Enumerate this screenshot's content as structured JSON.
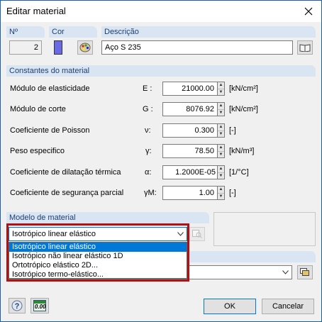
{
  "window": {
    "title": "Editar material"
  },
  "header": {
    "no_label": "Nº",
    "no_value": "2",
    "color_label": "Cor",
    "color_value": "#6a6ae8",
    "desc_label": "Descrição",
    "desc_value": "Aço S 235"
  },
  "constants": {
    "title": "Constantes do material",
    "rows": [
      {
        "label": "Módulo de elasticidade",
        "symbol": "E :",
        "value": "21000.00",
        "unit": "[kN/cm²]"
      },
      {
        "label": "Módulo de corte",
        "symbol": "G :",
        "value": "8076.92",
        "unit": "[kN/cm²]"
      },
      {
        "label": "Coeficiente de Poisson",
        "symbol": "ν:",
        "value": "0.300",
        "unit": "[-]"
      },
      {
        "label": "Peso especifico",
        "symbol": "γ:",
        "value": "78.50",
        "unit": "[kN/m³]"
      },
      {
        "label": "Coeficiente de dilatação térmica",
        "symbol": "α:",
        "value": "1.2000E-05",
        "unit": "[1/°C]"
      },
      {
        "label": "Coeficiente de segurança parcial",
        "symbol": "γM:",
        "value": "1.00",
        "unit": "[-]"
      }
    ]
  },
  "material_model": {
    "title": "Modelo de material",
    "selected": "Isotrópico linear elástico",
    "options": [
      "Isotrópico linear elástico",
      "Isotrópico não linear elástico 1D",
      "Ortotrópico elástico 2D...",
      "Isotrópico termo-elástico..."
    ]
  },
  "footer": {
    "units_icon_text": "0.00",
    "ok_label": "OK",
    "cancel_label": "Cancelar"
  },
  "colors": {
    "accent": "#0078d7",
    "group_header": "#d9e5f2",
    "highlight": "#b01214"
  }
}
